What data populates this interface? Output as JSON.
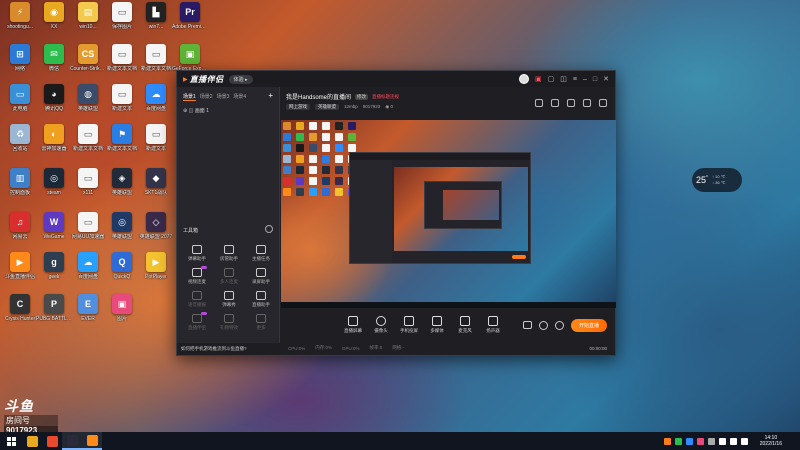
{
  "desktop_icons": [
    {
      "label": "shootingu...",
      "color": "#d98a2b",
      "glyph": "⚡"
    },
    {
      "label": "XX",
      "color": "#e8a820",
      "glyph": "◉"
    },
    {
      "label": "win10...",
      "color": "#f2c94c",
      "glyph": "▤"
    },
    {
      "label": "保存图片",
      "color": "#f5f5f5",
      "glyph": "▭"
    },
    {
      "label": "win7...",
      "color": "#222",
      "glyph": "▙"
    },
    {
      "label": "Adobe Premiere",
      "color": "#2a1a66",
      "glyph": "Pr"
    },
    {
      "label": "网络",
      "color": "#2b7bd6",
      "glyph": "⊞"
    },
    {
      "label": "微信",
      "color": "#2dbd4e",
      "glyph": "✉"
    },
    {
      "label": "Counter-Strike Global Off...",
      "color": "#e39b2f",
      "glyph": "CS"
    },
    {
      "label": "新建文本文档",
      "color": "#f5f5f5",
      "glyph": "▭"
    },
    {
      "label": "新建文本文档",
      "color": "#f5f5f5",
      "glyph": "▭"
    },
    {
      "label": "GeForce Experience",
      "color": "#5fb336",
      "glyph": "▣"
    },
    {
      "label": "此电脑",
      "color": "#3a8fd9",
      "glyph": "▭"
    },
    {
      "label": "腾讯QQ",
      "color": "#1a1a1a",
      "glyph": "◕"
    },
    {
      "label": "英雄联盟",
      "color": "#3b4c6b",
      "glyph": "◍"
    },
    {
      "label": "新建文本",
      "color": "#f5f5f5",
      "glyph": "▭"
    },
    {
      "label": "百度网盘",
      "color": "#2f8cff",
      "glyph": "☁"
    },
    {
      "label": "文件",
      "color": "#f5f5f5",
      "glyph": "▭"
    },
    {
      "label": "回收站",
      "color": "#9bb7d4",
      "glyph": "♻"
    },
    {
      "label": "雷神加速器",
      "color": "#f0a020",
      "glyph": "◐"
    },
    {
      "label": "新建文本文档",
      "color": "#f5f5f5",
      "glyph": "▭"
    },
    {
      "label": "新建文本文档",
      "color": "#2a7de1",
      "glyph": "⚑"
    },
    {
      "label": "新建文本",
      "color": "#f5f5f5",
      "glyph": "▭"
    },
    {
      "label": "文档",
      "color": "#f5f5f5",
      "glyph": "▭"
    },
    {
      "label": "控制面板",
      "color": "#3f7fc7",
      "glyph": "▥"
    },
    {
      "label": "steam",
      "color": "#1b2838",
      "glyph": "◎"
    },
    {
      "label": "x111",
      "color": "#f5f5f5",
      "glyph": "▭"
    },
    {
      "label": "英雄联盟",
      "color": "#202a38",
      "glyph": "◈"
    },
    {
      "label": "SKT1战队",
      "color": "#33334a",
      "glyph": "◆"
    },
    {
      "label": "Mo...",
      "color": "#3d3d52",
      "glyph": "M"
    },
    {
      "label": "网易云",
      "color": "#d92e2e",
      "glyph": "♫"
    },
    {
      "label": "WeGame",
      "color": "#5e3ac2",
      "glyph": "W"
    },
    {
      "label": "网易UU加速器",
      "color": "#f5f5f5",
      "glyph": "▭"
    },
    {
      "label": "英雄联盟",
      "color": "#1f3a66",
      "glyph": "◎"
    },
    {
      "label": "英雄联盟 2077",
      "color": "#3a2a4a",
      "glyph": "◇"
    },
    {
      "label": "confi...",
      "color": "#f5f5f5",
      "glyph": "▭"
    },
    {
      "label": "斗鱼直播伴侣",
      "color": "#ff8a1a",
      "glyph": "▶"
    },
    {
      "label": "geek",
      "color": "#2c3e50",
      "glyph": "g"
    },
    {
      "label": "百度网盘",
      "color": "#27a0ff",
      "glyph": "☁"
    },
    {
      "label": "QuickQ",
      "color": "#2e6bd6",
      "glyph": "Q"
    },
    {
      "label": "PotPlayer",
      "color": "#f2c230",
      "glyph": "▶"
    },
    {
      "label": "百度云",
      "color": "#6a5acd",
      "glyph": "◌"
    },
    {
      "label": "Crysis Hunter",
      "color": "#333",
      "glyph": "C"
    },
    {
      "label": "PUBG BATTLEGR...",
      "color": "#4a4a4a",
      "glyph": "P"
    },
    {
      "label": "EVER",
      "color": "#4f8fdd",
      "glyph": "E"
    },
    {
      "label": "图片",
      "color": "#e84a7b",
      "glyph": "▣"
    }
  ],
  "app": {
    "logo": "直播伴侣",
    "logo_mark": "▶",
    "version_pill": "体验 ▸",
    "scene_tabs": [
      "场景1",
      "场景2",
      "场景3",
      "场景4"
    ],
    "active_scene": 0,
    "scene_row": "⊕ ◫ 画面 1",
    "tools_title": "工具箱",
    "tools": [
      {
        "label": "弹幕助手",
        "dim": false,
        "badge": false
      },
      {
        "label": "房管助手",
        "dim": false,
        "badge": false
      },
      {
        "label": "主播任务",
        "dim": false,
        "badge": false
      },
      {
        "label": "视频连麦",
        "dim": false,
        "badge": true
      },
      {
        "label": "多人连麦",
        "dim": true,
        "badge": false
      },
      {
        "label": "录屏助手",
        "dim": false,
        "badge": false
      },
      {
        "label": "语音播报",
        "dim": true,
        "badge": false
      },
      {
        "label": "弹幕秀",
        "dim": false,
        "badge": false
      },
      {
        "label": "直播助手",
        "dim": false,
        "badge": false
      },
      {
        "label": "直播伴侣",
        "dim": true,
        "badge": true
      },
      {
        "label": "礼物特效",
        "dim": true,
        "badge": false
      },
      {
        "label": "更多",
        "dim": true,
        "badge": false
      }
    ],
    "notice": "如何把手机游戏推流到斗鱼直播?",
    "room_title": "我是Handsome的直播间",
    "room_edit": "修改",
    "room_warn": "直播标题违规",
    "room_meta": [
      "网上游戏",
      "英雄联盟",
      "12mbp",
      "9017923",
      "◉ 0"
    ],
    "controls": [
      {
        "label": "直播屏幕",
        "round": false
      },
      {
        "label": "摄像头",
        "round": true
      },
      {
        "label": "手机投屏",
        "round": false
      },
      {
        "label": "多媒体",
        "round": false
      },
      {
        "label": "麦克风",
        "round": false
      },
      {
        "label": "扬声器",
        "round": false
      }
    ],
    "live_button": "开始直播",
    "status_items": [
      "CPU:0%",
      "内存:0%",
      "GPU:0%",
      "帧率:0",
      "网络:-"
    ],
    "status_time": "00:00:00"
  },
  "weather": {
    "temp": "25",
    "unit": "°",
    "row1": "↑ 10 ℃",
    "row2": "↓ 36 ℃"
  },
  "mini_pill": "1.2K",
  "room_widget": {
    "logo": "斗鱼",
    "label": "房间号",
    "number": "9017923"
  },
  "taskbar": {
    "apps": [
      {
        "color": "#e8a820",
        "active": false
      },
      {
        "color": "#e84a2b",
        "active": false
      },
      {
        "color": "#2a2a3a",
        "active": true
      },
      {
        "color": "#ff8a1a",
        "active": true
      }
    ],
    "tray_colors": [
      "#ff7a1a",
      "#2dbd4e",
      "#2f8cff",
      "#e84a7b",
      "#aaaaaa",
      "#ffffff",
      "#ffffff",
      "#ffffff"
    ],
    "time": "14:10",
    "date": "2022/1/16"
  }
}
